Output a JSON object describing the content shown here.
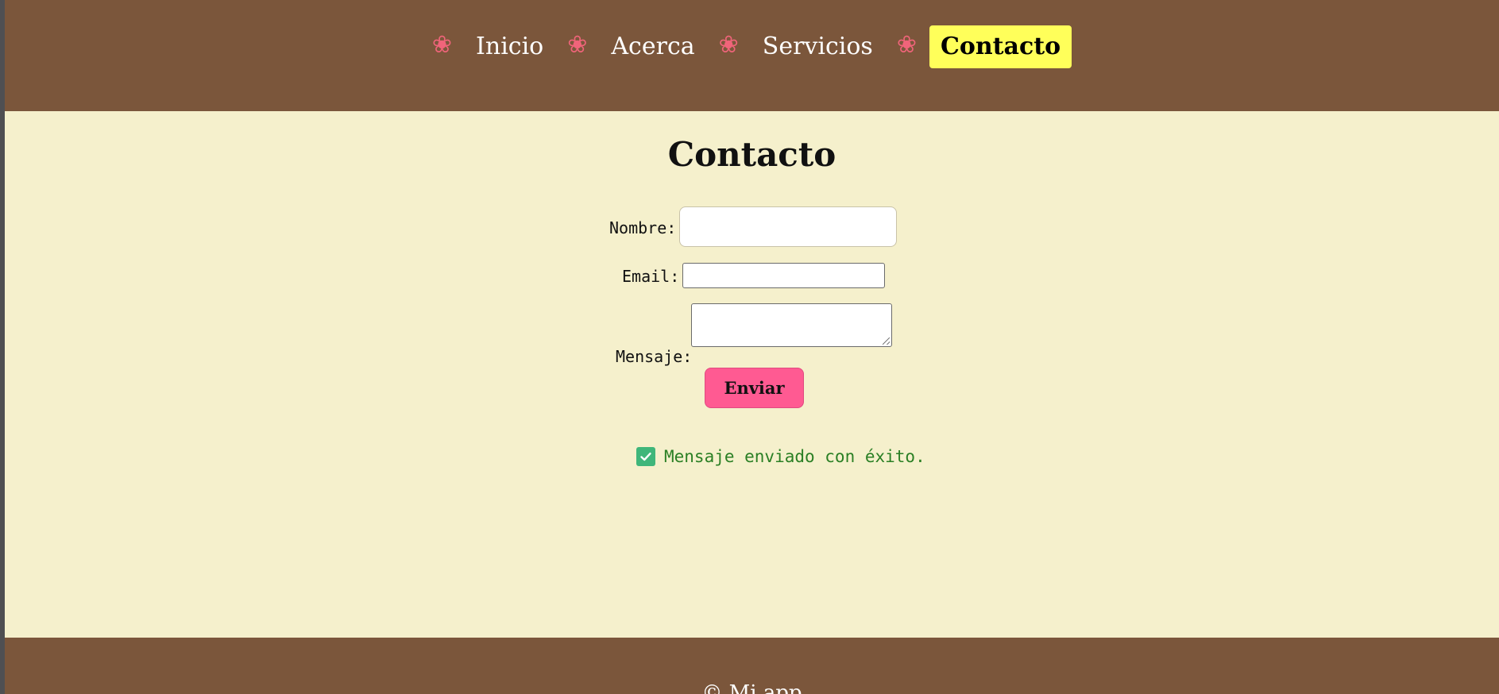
{
  "nav": {
    "items": [
      {
        "label": "Inicio",
        "icon": "flower-icon",
        "active": false
      },
      {
        "label": "Acerca",
        "icon": "flower-icon",
        "active": false
      },
      {
        "label": "Servicios",
        "icon": "flower-icon",
        "active": false
      },
      {
        "label": "Contacto",
        "icon": "flower-icon",
        "active": true
      }
    ]
  },
  "main": {
    "title": "Contacto"
  },
  "form": {
    "nombre_label": "Nombre:",
    "nombre_value": "",
    "email_label": "Email:",
    "email_value": "",
    "mensaje_label": "Mensaje:",
    "mensaje_value": "",
    "submit_label": "Enviar"
  },
  "status": {
    "icon": "check-icon",
    "message": "Mensaje enviado con éxito."
  },
  "footer": {
    "text": "© Mi app"
  },
  "colors": {
    "header_bg": "#7b563b",
    "page_bg": "#f5f0cc",
    "active_nav_bg": "#ffff5a",
    "flower": "#f0647a",
    "button_bg": "#ff5a92",
    "success_text": "#2a7f24",
    "check_bg": "#3fb67a"
  }
}
